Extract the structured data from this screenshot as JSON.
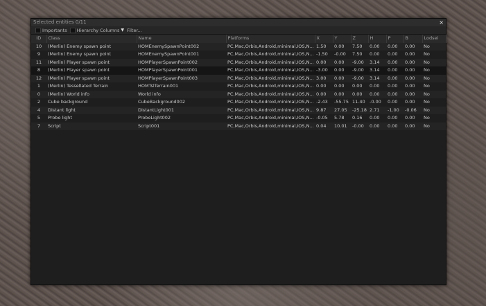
{
  "window": {
    "title": "Selected entities 0/11",
    "close_glyph": "×"
  },
  "toolbar": {
    "importants_label": "Importants",
    "hierarchy_label": "Hierarchy Columns",
    "filter_label": "Filter..."
  },
  "columns": [
    "ID",
    "Class",
    "Name",
    "Platforms",
    "X",
    "Y",
    "Z",
    "H",
    "P",
    "B",
    "Lodsei"
  ],
  "rows": [
    {
      "id": "10",
      "class": "(Merlin) Enemy spawn point",
      "name": "HOMEnemySpawnPoint002",
      "platforms": "PC,Mac,Orbis,Android,minimal,IOS,N...",
      "x": "1.50",
      "y": "0.00",
      "z": "7.50",
      "h": "0.00",
      "p": "0.00",
      "b": "0.00",
      "lod": "No"
    },
    {
      "id": "9",
      "class": "(Merlin) Enemy spawn point",
      "name": "HOMEnemySpawnPoint001",
      "platforms": "PC,Mac,Orbis,Android,minimal,IOS,N...",
      "x": "-1.50",
      "y": "-0.00",
      "z": "7.50",
      "h": "0.00",
      "p": "0.00",
      "b": "0.00",
      "lod": "No"
    },
    {
      "id": "11",
      "class": "(Merlin) Player spawn point",
      "name": "HOMPlayerSpawnPoint002",
      "platforms": "PC,Mac,Orbis,Android,minimal,IOS,N...",
      "x": "0.00",
      "y": "0.00",
      "z": "-9.00",
      "h": "3.14",
      "p": "0.00",
      "b": "0.00",
      "lod": "No"
    },
    {
      "id": "8",
      "class": "(Merlin) Player spawn point",
      "name": "HOMPlayerSpawnPoint001",
      "platforms": "PC,Mac,Orbis,Android,minimal,IOS,N...",
      "x": "-3.00",
      "y": "0.00",
      "z": "-9.00",
      "h": "3.14",
      "p": "0.00",
      "b": "0.00",
      "lod": "No"
    },
    {
      "id": "12",
      "class": "(Merlin) Player spawn point",
      "name": "HOMPlayerSpawnPoint003",
      "platforms": "PC,Mac,Orbis,Android,minimal,IOS,N...",
      "x": "3.00",
      "y": "0.00",
      "z": "-9.00",
      "h": "3.14",
      "p": "0.00",
      "b": "0.00",
      "lod": "No"
    },
    {
      "id": "1",
      "class": "(Merlin) Tessellated Terrain",
      "name": "HOMTslTerrain001",
      "platforms": "PC,Mac,Orbis,Android,minimal,IOS,N...",
      "x": "0.00",
      "y": "0.00",
      "z": "0.00",
      "h": "0.00",
      "p": "0.00",
      "b": "0.00",
      "lod": "No"
    },
    {
      "id": "0",
      "class": "(Merlin) World info",
      "name": "World info",
      "platforms": "PC,Mac,Orbis,Android,minimal,IOS,N...",
      "x": "0.00",
      "y": "0.00",
      "z": "0.00",
      "h": "0.00",
      "p": "0.00",
      "b": "0.00",
      "lod": "No"
    },
    {
      "id": "2",
      "class": "Cube background",
      "name": "CubeBackground002",
      "platforms": "PC,Mac,Orbis,Android,minimal,IOS,N...",
      "x": "-2.43",
      "y": "-55.75",
      "z": "11.40",
      "h": "-0.00",
      "p": "0.00",
      "b": "0.00",
      "lod": "No"
    },
    {
      "id": "4",
      "class": "Distant light",
      "name": "DistantLight001",
      "platforms": "PC,Mac,Orbis,Android,minimal,IOS,N...",
      "x": "9.87",
      "y": "27.05",
      "z": "-25.18",
      "h": "2.71",
      "p": "-1.00",
      "b": "-0.06",
      "lod": "No"
    },
    {
      "id": "5",
      "class": "Probe light",
      "name": "ProbeLight002",
      "platforms": "PC,Mac,Orbis,Android,minimal,IOS,N...",
      "x": "-0.05",
      "y": "5.78",
      "z": "0.16",
      "h": "0.00",
      "p": "0.00",
      "b": "0.00",
      "lod": "No"
    },
    {
      "id": "7",
      "class": "Script",
      "name": "Script001",
      "platforms": "PC,Mac,Orbis,Android,minimal,IOS,N...",
      "x": "0.04",
      "y": "10.01",
      "z": "-0.00",
      "h": "0.00",
      "p": "0.00",
      "b": "0.00",
      "lod": "No"
    }
  ]
}
